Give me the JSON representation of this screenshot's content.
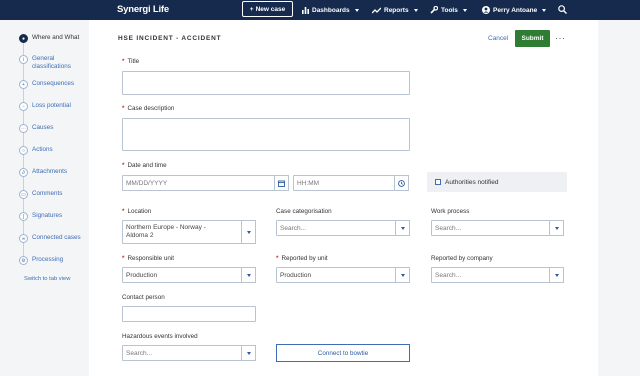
{
  "topbar": {
    "logo": "Synergi Life",
    "new_case": "New case",
    "dashboards": "Dashboards",
    "reports": "Reports",
    "tools": "Tools",
    "user": "Perry Antoane"
  },
  "sidebar": {
    "items": [
      {
        "label": "Where and What",
        "icon": "pin-icon"
      },
      {
        "label": "General classifications",
        "icon": "info-icon"
      },
      {
        "label": "Consequences",
        "icon": "consequences-icon"
      },
      {
        "label": "Loss potential",
        "icon": "loss-icon"
      },
      {
        "label": "Causes",
        "icon": "causes-icon"
      },
      {
        "label": "Actions",
        "icon": "actions-icon"
      },
      {
        "label": "Attachments",
        "icon": "attachment-icon"
      },
      {
        "label": "Comments",
        "icon": "comment-icon"
      },
      {
        "label": "Signatures",
        "icon": "signature-icon"
      },
      {
        "label": "Connected cases",
        "icon": "link-icon"
      },
      {
        "label": "Processing",
        "icon": "processing-icon"
      }
    ],
    "switch_view": "Switch to tab view"
  },
  "form": {
    "title": "HSE INCIDENT - ACCIDENT",
    "cancel": "Cancel",
    "submit": "Submit",
    "more": "···",
    "title_label": "Title",
    "description_label": "Case description",
    "datetime_label": "Date and time",
    "date_placeholder": "MM/DD/YYYY",
    "time_placeholder": "HH:MM",
    "authorities": "Authorities notified",
    "location_label": "Location",
    "location_value_1": "Northern Europe - Norway -",
    "location_value_2": "Aldoma 2",
    "case_cat_label": "Case categorisation",
    "work_process_label": "Work process",
    "search_placeholder": "Search...",
    "responsible_unit_label": "Responsible unit",
    "responsible_unit_value": "Production",
    "reported_unit_label": "Reported by unit",
    "reported_unit_value": "Production",
    "reported_company_label": "Reported by company",
    "contact_label": "Contact person",
    "hazardous_label": "Hazardous events involved",
    "bowtie": "Connect to bowtie"
  },
  "colors": {
    "topbar": "#162a4d",
    "submit": "#2e7d32",
    "link": "#3d6db5",
    "required": "#c0392b"
  }
}
